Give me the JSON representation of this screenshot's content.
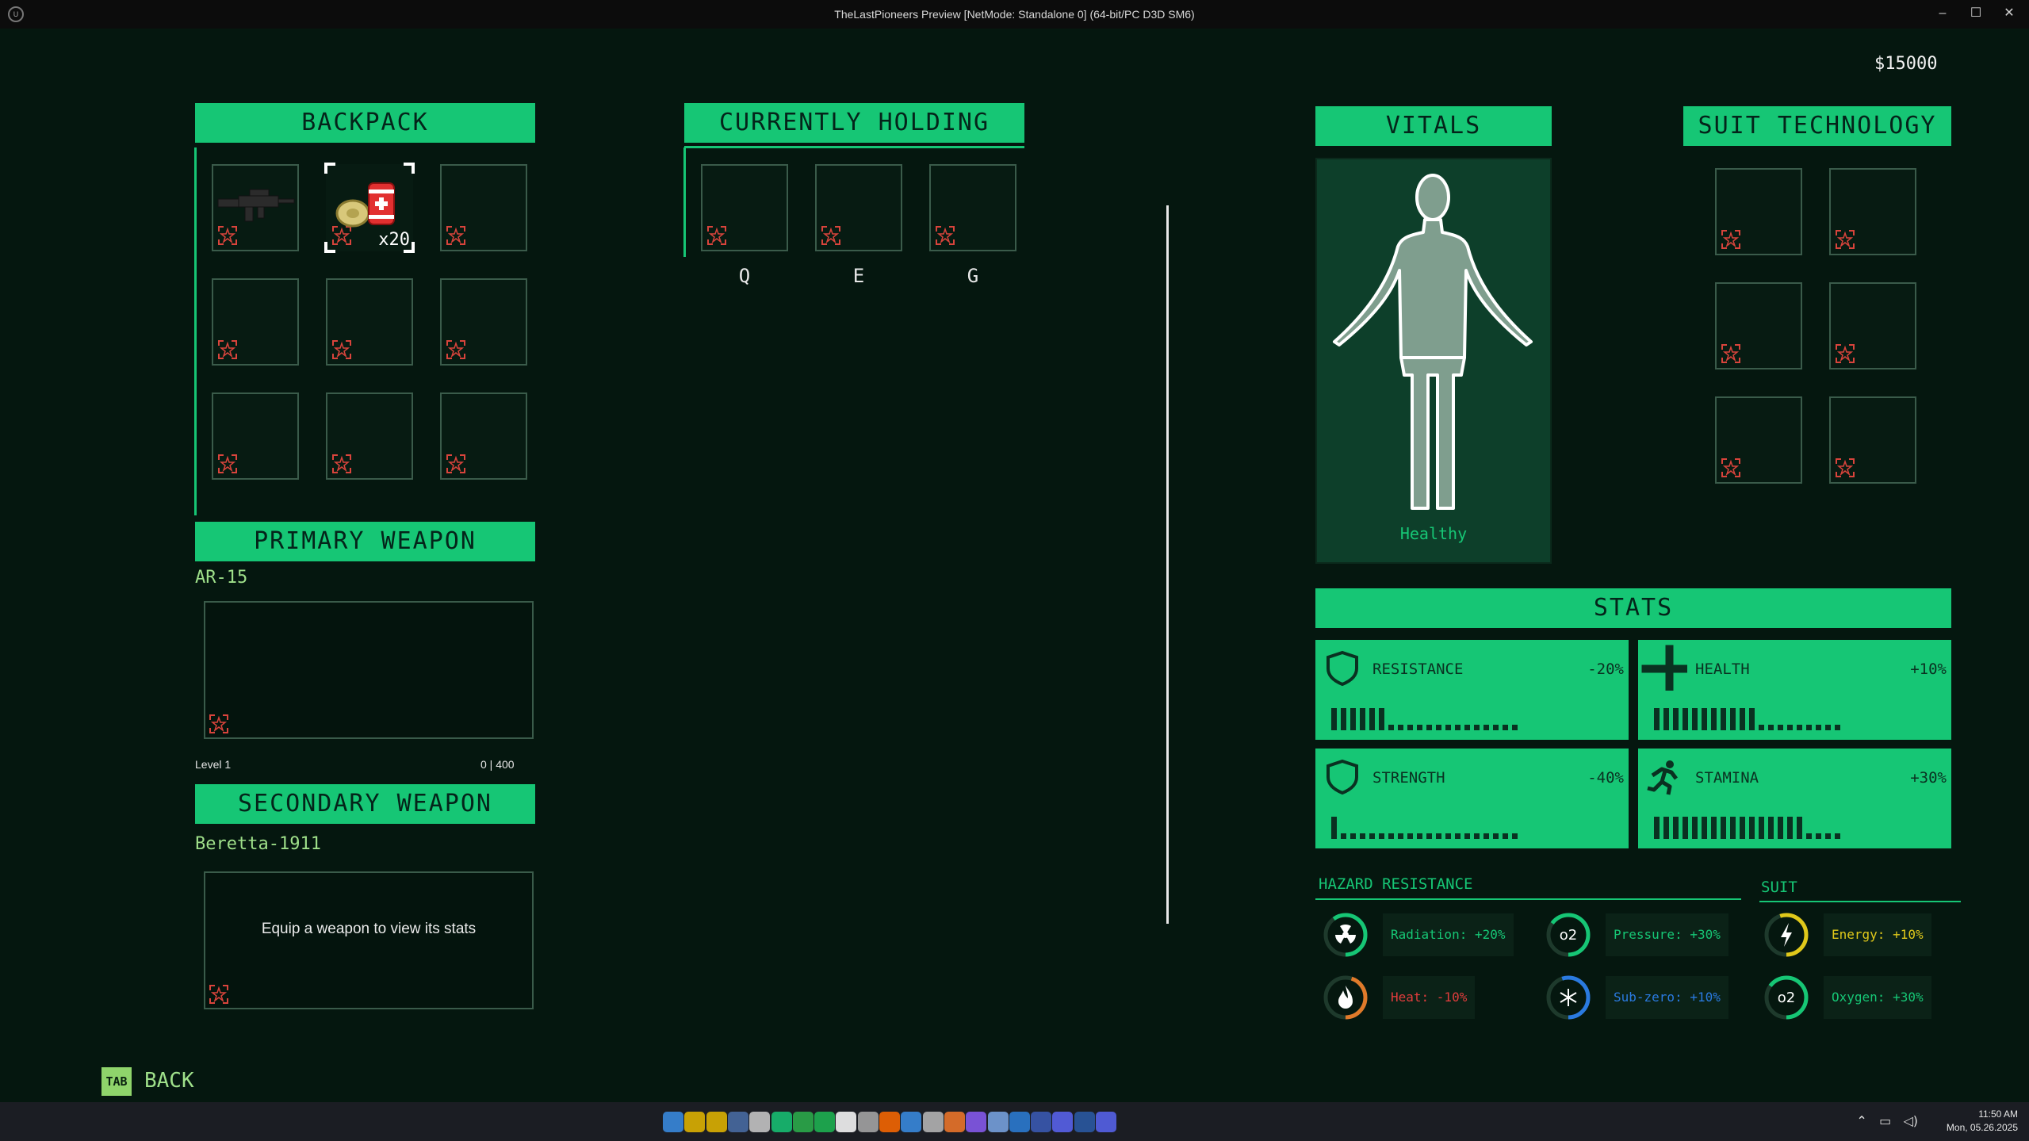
{
  "window": {
    "title": "TheLastPioneers Preview [NetMode: Standalone 0]  (64-bit/PC D3D SM6)",
    "logo_text": "U",
    "min": "–",
    "max": "☐",
    "close": "✕"
  },
  "money": "$15000",
  "backpack": {
    "title": "BACKPACK",
    "slots": [
      {
        "item": "rifle",
        "count": ""
      },
      {
        "item": "medkit-and-bandage",
        "count": "x20",
        "selected": true
      },
      {
        "item": "",
        "count": ""
      },
      {
        "item": "",
        "count": ""
      },
      {
        "item": "",
        "count": ""
      },
      {
        "item": "",
        "count": ""
      },
      {
        "item": "",
        "count": ""
      },
      {
        "item": "",
        "count": ""
      },
      {
        "item": "",
        "count": ""
      }
    ]
  },
  "holding": {
    "title": "CURRENTLY HOLDING",
    "keys": [
      "Q",
      "E",
      "G"
    ]
  },
  "primary": {
    "title": "PRIMARY WEAPON",
    "name": "AR-15",
    "level": "Level 1",
    "xp": "0 | 400"
  },
  "secondary": {
    "title": "SECONDARY WEAPON",
    "name": "Beretta-1911",
    "hint": "Equip a weapon to view its stats"
  },
  "vitals": {
    "title": "VITALS",
    "status": "Healthy"
  },
  "suit_tech": {
    "title": "SUIT TECHNOLOGY"
  },
  "stats": {
    "title": "STATS",
    "items": [
      {
        "name": "RESISTANCE",
        "value": "-20%",
        "icon": "shield-icon",
        "level": 6,
        "max": 20
      },
      {
        "name": "HEALTH",
        "value": "+10%",
        "icon": "cross-icon",
        "level": 11,
        "max": 20
      },
      {
        "name": "STRENGTH",
        "value": "-40%",
        "icon": "shield-icon",
        "level": 1,
        "max": 20
      },
      {
        "name": "STAMINA",
        "value": "+30%",
        "icon": "running-icon",
        "level": 16,
        "max": 20
      }
    ]
  },
  "hazard": {
    "title": "HAZARD RESISTANCE",
    "items": [
      {
        "label": "Radiation: +20%",
        "icon": "radiation-icon",
        "color": "#16c675",
        "level": 0.6
      },
      {
        "label": "Pressure: +30%",
        "icon": "o2",
        "color": "#16c675",
        "level": 0.65
      },
      {
        "label": "Heat: -10%",
        "icon": "flame-icon",
        "color": "#e07a2a",
        "level": 0.45,
        "text_color": "#e03c3c"
      },
      {
        "label": "Sub-zero: +10%",
        "icon": "snowflake-icon",
        "color": "#2a7ae0",
        "level": 0.55
      }
    ]
  },
  "suit": {
    "title": "SUIT",
    "items": [
      {
        "label": "Energy: +10%",
        "icon": "lightning-icon",
        "color": "#e0c81a",
        "level": 0.55
      },
      {
        "label": "Oxygen: +30%",
        "icon": "o2",
        "color": "#16c675",
        "level": 0.65
      }
    ]
  },
  "footer": {
    "tab_key": "TAB",
    "back_label": "BACK"
  },
  "taskbar": {
    "time": "11:50 AM",
    "date": "Mon, 05.26.2025"
  }
}
